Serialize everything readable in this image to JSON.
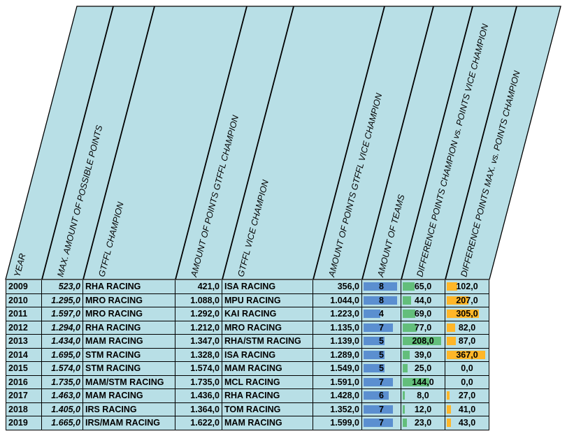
{
  "headers": [
    "YEAR",
    "MAX. AMOUNT OF POSSIBLE POINTS",
    "GTFFL CHAMPION",
    "AMOUNT OF POINTS GTFFL CHAMPION",
    "GTFFL VICE CHAMPION",
    "AMOUNT OF POINTS GTFFL VICE CHAMPION",
    "AMOUNT OF TEAMS",
    "DIFFERENCE POINTS CHAMPION vs. POINTS VICE CHAMPION",
    "DIFFERENCE POINTS MAX. vs. POINTS CHAMPION"
  ],
  "colors": {
    "header_bg": "#b8dfe6",
    "teams_bar": "#5b8fd0",
    "diff_bar": "#63be7b",
    "max_bar": "#ffb628"
  },
  "rows": [
    {
      "year": "2009",
      "max": "523,0",
      "champ": "RHA RACING",
      "champ_pts": "421,0",
      "vice": "ISA RACING",
      "vice_pts": "356,0",
      "teams": "8",
      "diff": "65,0",
      "maxdiff": "102,0",
      "teams_n": 8,
      "diff_n": 65,
      "maxdiff_n": 102
    },
    {
      "year": "2010",
      "max": "1.295,0",
      "champ": "MRO RACING",
      "champ_pts": "1.088,0",
      "vice": "MPU RACING",
      "vice_pts": "1.044,0",
      "teams": "8",
      "diff": "44,0",
      "maxdiff": "207,0",
      "teams_n": 8,
      "diff_n": 44,
      "maxdiff_n": 207
    },
    {
      "year": "2011",
      "max": "1.597,0",
      "champ": "MRO RACING",
      "champ_pts": "1.292,0",
      "vice": "KAI RACING",
      "vice_pts": "1.223,0",
      "teams": "4",
      "diff": "69,0",
      "maxdiff": "305,0",
      "teams_n": 4,
      "diff_n": 69,
      "maxdiff_n": 305
    },
    {
      "year": "2012",
      "max": "1.294,0",
      "champ": "RHA RACING",
      "champ_pts": "1.212,0",
      "vice": "MRO RACING",
      "vice_pts": "1.135,0",
      "teams": "7",
      "diff": "77,0",
      "maxdiff": "82,0",
      "teams_n": 7,
      "diff_n": 77,
      "maxdiff_n": 82
    },
    {
      "year": "2013",
      "max": "1.434,0",
      "champ": "MAM RACING",
      "champ_pts": "1.347,0",
      "vice": "RHA/STM RACING",
      "vice_pts": "1.139,0",
      "teams": "5",
      "diff": "208,0",
      "maxdiff": "87,0",
      "teams_n": 5,
      "diff_n": 208,
      "maxdiff_n": 87
    },
    {
      "year": "2014",
      "max": "1.695,0",
      "champ": "STM RACING",
      "champ_pts": "1.328,0",
      "vice": "ISA RACING",
      "vice_pts": "1.289,0",
      "teams": "5",
      "diff": "39,0",
      "maxdiff": "367,0",
      "teams_n": 5,
      "diff_n": 39,
      "maxdiff_n": 367
    },
    {
      "year": "2015",
      "max": "1.574,0",
      "champ": "STM RACING",
      "champ_pts": "1.574,0",
      "vice": "MAM RACING",
      "vice_pts": "1.549,0",
      "teams": "5",
      "diff": "25,0",
      "maxdiff": "0,0",
      "teams_n": 5,
      "diff_n": 25,
      "maxdiff_n": 0
    },
    {
      "year": "2016",
      "max": "1.735,0",
      "champ": "MAM/STM RACING",
      "champ_pts": "1.735,0",
      "vice": "MCL RACING",
      "vice_pts": "1.591,0",
      "teams": "7",
      "diff": "144,0",
      "maxdiff": "0,0",
      "teams_n": 7,
      "diff_n": 144,
      "maxdiff_n": 0
    },
    {
      "year": "2017",
      "max": "1.463,0",
      "champ": "MAM RACING",
      "champ_pts": "1.436,0",
      "vice": "RHA RACING",
      "vice_pts": "1.428,0",
      "teams": "6",
      "diff": "8,0",
      "maxdiff": "27,0",
      "teams_n": 6,
      "diff_n": 8,
      "maxdiff_n": 27
    },
    {
      "year": "2018",
      "max": "1.405,0",
      "champ": "IRS RACING",
      "champ_pts": "1.364,0",
      "vice": "TOM RACING",
      "vice_pts": "1.352,0",
      "teams": "7",
      "diff": "12,0",
      "maxdiff": "41,0",
      "teams_n": 7,
      "diff_n": 12,
      "maxdiff_n": 41
    },
    {
      "year": "2019",
      "max": "1.665,0",
      "champ": "IRS/MAM RACING",
      "champ_pts": "1.622,0",
      "vice": "MAM RACING",
      "vice_pts": "1.599,0",
      "teams": "7",
      "diff": "23,0",
      "maxdiff": "43,0",
      "teams_n": 7,
      "diff_n": 23,
      "maxdiff_n": 43
    }
  ]
}
